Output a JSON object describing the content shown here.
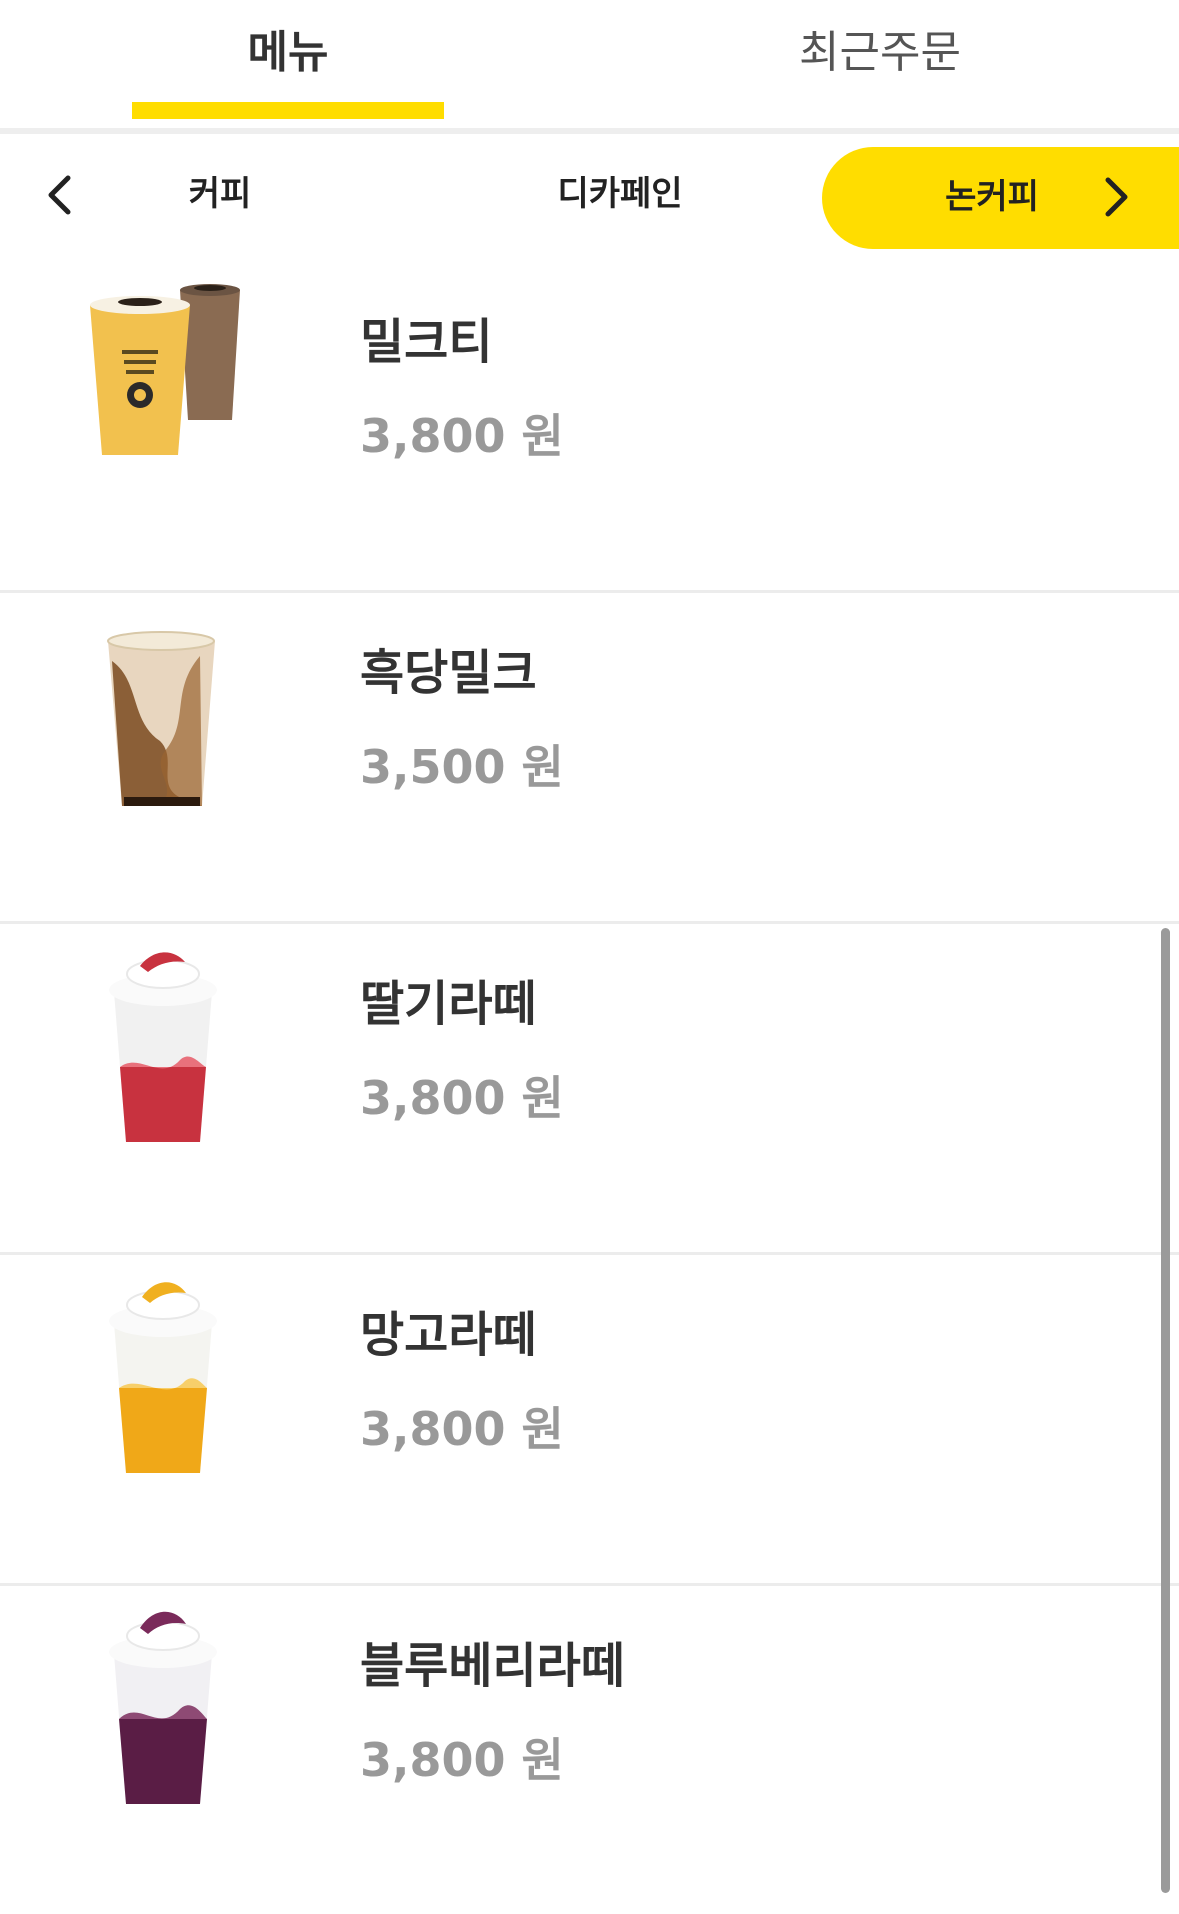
{
  "top_tabs": {
    "menu": "메뉴",
    "recent_orders": "최근주문"
  },
  "categories": {
    "prev_icon": "chevron-left-icon",
    "next_icon": "chevron-right-icon",
    "items": [
      "커피",
      "디카페인",
      "논커피"
    ],
    "active": "논커피"
  },
  "colors": {
    "accent": "#FFDD00",
    "price": "#999999"
  },
  "menu_items": [
    {
      "name": "밀크티",
      "price": "3,800 원",
      "image": "milk-tea-cups"
    },
    {
      "name": "흑당밀크",
      "price": "3,500 원",
      "image": "brown-sugar-milk-cup"
    },
    {
      "name": "딸기라떼",
      "price": "3,800 원",
      "image": "strawberry-latte-cup"
    },
    {
      "name": "망고라떼",
      "price": "3,800 원",
      "image": "mango-latte-cup"
    },
    {
      "name": "블루베리라떼",
      "price": "3,800 원",
      "image": "blueberry-latte-cup"
    }
  ]
}
